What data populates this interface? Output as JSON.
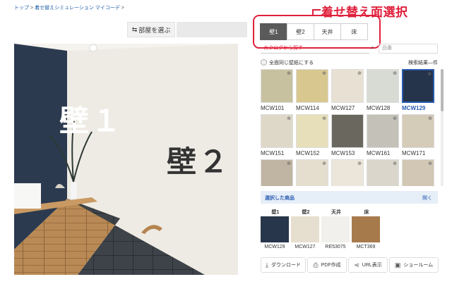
{
  "breadcrumb": {
    "home": "トップ",
    "parent": "着せ替えシミュレーション マイコーデ",
    "trail_end": ">"
  },
  "toolbar": {
    "room_select": "部屋を選ぶ"
  },
  "annotation": {
    "text": "着せ替え面選択"
  },
  "surface_tabs": [
    {
      "label": "壁1",
      "active": true
    },
    {
      "label": "壁2",
      "active": false
    },
    {
      "label": "天井",
      "active": false
    },
    {
      "label": "床",
      "active": false
    }
  ],
  "room_preview": {
    "wall1_label": "壁１",
    "wall2_label": "壁２"
  },
  "search": {
    "catalog_placeholder": "カタログから探す",
    "sku_placeholder": "品番"
  },
  "options": {
    "same_wallpaper": "全面同じ壁紙にする",
    "result_count": "検索結果―件"
  },
  "swatches": [
    {
      "code": "MCW101",
      "color": "#c7c1a0",
      "selected": false
    },
    {
      "code": "MCW114",
      "color": "#d8c78f",
      "selected": false
    },
    {
      "code": "MCW127",
      "color": "#e8e1d3",
      "selected": false
    },
    {
      "code": "MCW128",
      "color": "#d8dad4",
      "selected": false
    },
    {
      "code": "MCW129",
      "color": "#25344a",
      "selected": true
    },
    {
      "code": "MCW151",
      "color": "#ded8c8",
      "selected": false
    },
    {
      "code": "MCW152",
      "color": "#e7dfba",
      "selected": false
    },
    {
      "code": "MCW153",
      "color": "#6a675f",
      "selected": false
    },
    {
      "code": "MCW161",
      "color": "#c3c1b8",
      "selected": false
    },
    {
      "code": "MCW171",
      "color": "#d4cbb8",
      "selected": false
    },
    {
      "code": "",
      "color": "#bfb5a2",
      "selected": false
    },
    {
      "code": "",
      "color": "#e5decf",
      "selected": false
    },
    {
      "code": "",
      "color": "#ece6da",
      "selected": false
    },
    {
      "code": "",
      "color": "#dad6cc",
      "selected": false
    },
    {
      "code": "",
      "color": "#d2c7b4",
      "selected": false
    }
  ],
  "selected_products": {
    "title": "選択した商品",
    "toggle": "開く",
    "items": [
      {
        "surface": "壁1",
        "code": "MCW129",
        "color": "#27364a"
      },
      {
        "surface": "壁2",
        "code": "MCW127",
        "color": "#e6dfcf"
      },
      {
        "surface": "天井",
        "code": "RE53075",
        "color": "#f1f0ec"
      },
      {
        "surface": "床",
        "code": "MCT369",
        "color": "#a77a4c"
      }
    ]
  },
  "actions": [
    {
      "label": "ダウンロード",
      "icon": "download-icon"
    },
    {
      "label": "PDF作成",
      "icon": "printer-icon"
    },
    {
      "label": "URL表示",
      "icon": "share-icon"
    },
    {
      "label": "ショールーム",
      "icon": "showroom-icon"
    }
  ],
  "colors": {
    "accent_red": "#e0203c",
    "selected_blue": "#2a5cb0",
    "wall1_navy": "#27364a"
  }
}
